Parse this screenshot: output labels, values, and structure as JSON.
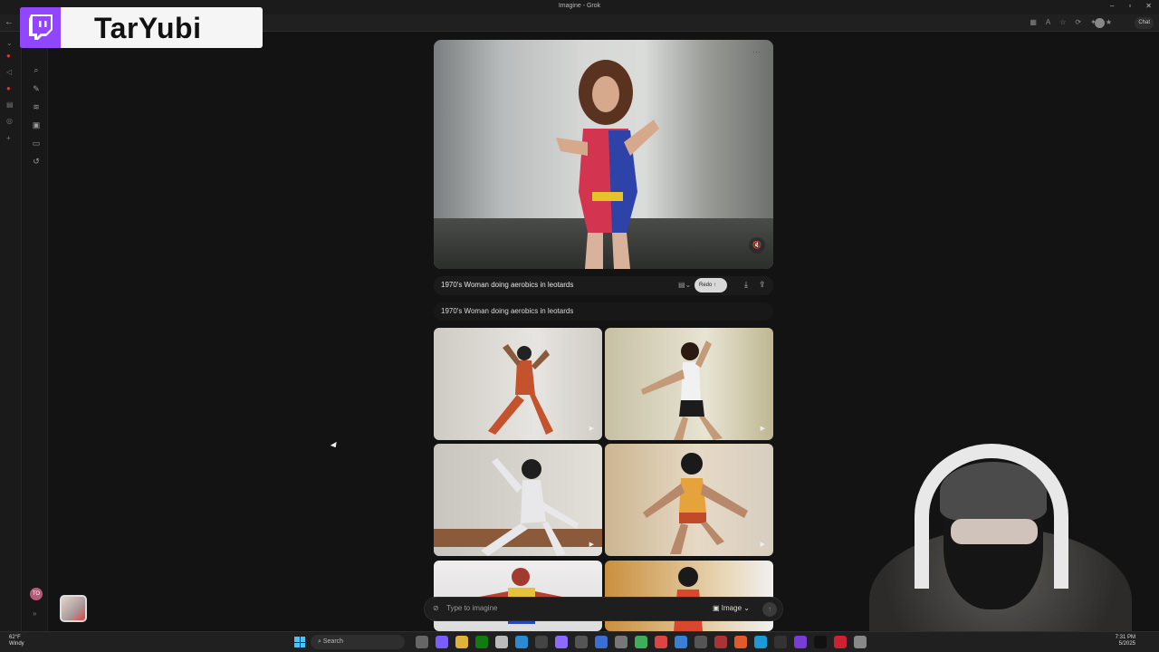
{
  "browser": {
    "tab_title": "Imagine - Grok",
    "chat_label": "Chat"
  },
  "overlay": {
    "channel_name": "TarYubi"
  },
  "sidebar": {
    "user_initials": "TO"
  },
  "main": {
    "prompt_text": "1970's Woman doing aerobics in leotards",
    "redo_label": "Redo",
    "history_prompt": "1970's Woman doing aerobics in leotards"
  },
  "composer": {
    "placeholder": "Type to imagine",
    "mode_label": "Image"
  },
  "taskbar": {
    "temperature": "62°F",
    "weather_condition": "Windy",
    "search_label": "Search",
    "time": "7:31 PM",
    "date": "5/2025"
  },
  "colors": {
    "twitch_purple": "#9146ff",
    "background": "#131313",
    "windows_blue": "#4cc2ff"
  }
}
